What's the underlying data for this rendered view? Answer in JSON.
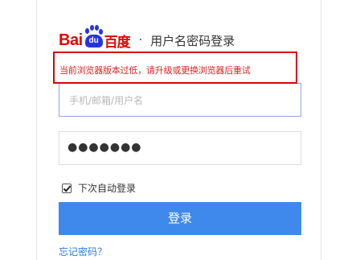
{
  "header": {
    "logo_latin": "Bai",
    "logo_paw_text": "du",
    "logo_chinese": "百度",
    "separator": "·",
    "title": "用户名密码登录"
  },
  "warning": {
    "text": "当前浏览器版本过低，请升级或更换浏览器后重试"
  },
  "form": {
    "username_placeholder": "手机/邮箱/用户名",
    "password_masked": "●●●●●●●",
    "remember_label": "下次自动登录",
    "remember_checked": true,
    "login_label": "登录",
    "forgot_label": "忘记密码？"
  },
  "colors": {
    "brand_red": "#e10601",
    "brand_blue": "#2932e1",
    "button_blue": "#3f89ec",
    "warning_red": "#e00000",
    "link_blue": "#2a7ae2"
  }
}
